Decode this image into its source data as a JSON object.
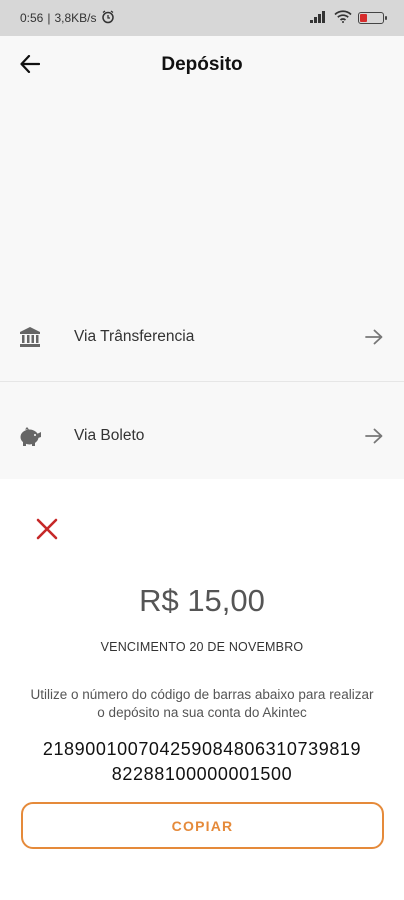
{
  "status_bar": {
    "time": "0:56",
    "network_speed": "3,8KB/s",
    "battery_level": 0.3,
    "battery_color": "#d62b2b"
  },
  "app_bar": {
    "title": "Depósito",
    "back_icon": "arrow-left-icon"
  },
  "options": [
    {
      "label": "Via Trânsferencia",
      "icon": "bank-icon",
      "arrow_icon": "arrow-right-icon"
    },
    {
      "label": "Via Boleto",
      "icon": "piggy-bank-icon",
      "arrow_icon": "arrow-right-icon"
    }
  ],
  "sheet": {
    "close_icon": "close-icon",
    "close_color": "#c62828",
    "amount": "R$ 15,00",
    "due_date": "VENCIMENTO 20 DE NOVEMBRO",
    "instructions": "Utilize o número do código de barras abaixo para realizar o depósito na sua conta do Akintec",
    "barcode_line1": "21890010070425908480631073981​9",
    "barcode_line2": "82288100000001500",
    "copy_button": "COPIAR",
    "accent_color": "#e58a3a"
  }
}
